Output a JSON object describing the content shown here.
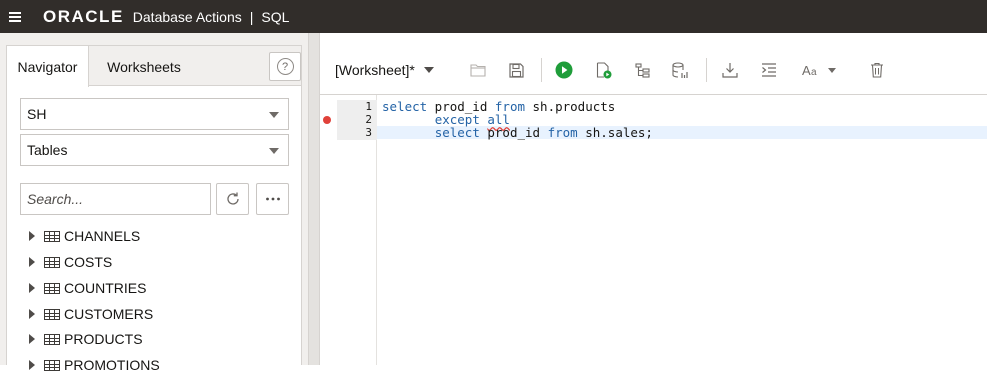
{
  "header": {
    "brand": "ORACLE",
    "app_name": "Database Actions",
    "separator": "|",
    "section": "SQL"
  },
  "navigator": {
    "tabs": [
      {
        "label": "Navigator",
        "active": true
      },
      {
        "label": "Worksheets",
        "active": false
      }
    ],
    "help_icon": "?",
    "schema_select": "SH",
    "object_type_select": "Tables",
    "search_placeholder": "Search...",
    "tables": [
      "CHANNELS",
      "COSTS",
      "COUNTRIES",
      "CUSTOMERS",
      "PRODUCTS",
      "PROMOTIONS"
    ]
  },
  "worksheet": {
    "title": "[Worksheet]*",
    "toolbar_icons": [
      "open-folder-icon",
      "save-icon",
      "run-statement-icon",
      "run-script-icon",
      "explain-plan-icon",
      "autotrace-icon",
      "download-icon",
      "format-icon",
      "font-size-icon",
      "clear-icon"
    ],
    "line_numbers": [
      "1",
      "2",
      "3"
    ],
    "code": {
      "line1": {
        "kw1": "select",
        "t1": " prod_id ",
        "kw2": "from",
        "t2": " sh.products"
      },
      "line2": {
        "indent": "       ",
        "kw1": "except",
        "t1": " ",
        "kw2": "all"
      },
      "line3": {
        "indent": "       ",
        "kw1": "select",
        "t1": " prod_id ",
        "kw2": "from",
        "t2": " sh.sales;"
      }
    },
    "colors": {
      "keyword": "#2463a6",
      "error_marker": "#e0413a",
      "run_green": "#1f9d3a",
      "active_line": "#e8f2fe"
    }
  }
}
